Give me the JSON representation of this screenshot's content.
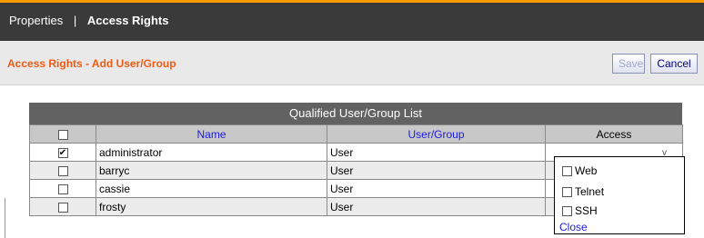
{
  "header": {
    "tabs": [
      {
        "label": "Properties",
        "active": false
      },
      {
        "label": "Access Rights",
        "active": true
      }
    ],
    "separator": "|"
  },
  "subheader": {
    "title": "Access Rights - Add User/Group",
    "save_label": "Save",
    "cancel_label": "Cancel"
  },
  "list": {
    "title": "Qualified User/Group List",
    "columns": [
      "Name",
      "User/Group",
      "Access"
    ],
    "rows": [
      {
        "name": "administrator",
        "type": "User",
        "checked": true
      },
      {
        "name": "barryc",
        "type": "User",
        "checked": false
      },
      {
        "name": "cassie",
        "type": "User",
        "checked": false
      },
      {
        "name": "frosty",
        "type": "User",
        "checked": false
      }
    ]
  },
  "access_popup": {
    "options": [
      {
        "label": "Web",
        "checked": false
      },
      {
        "label": "Telnet",
        "checked": false
      },
      {
        "label": "SSH",
        "checked": false
      }
    ],
    "close_label": "Close"
  },
  "colors": {
    "topbar": "#3a3a3a",
    "accent_orange": "#f05a14",
    "link_blue": "#1a1ae0"
  }
}
